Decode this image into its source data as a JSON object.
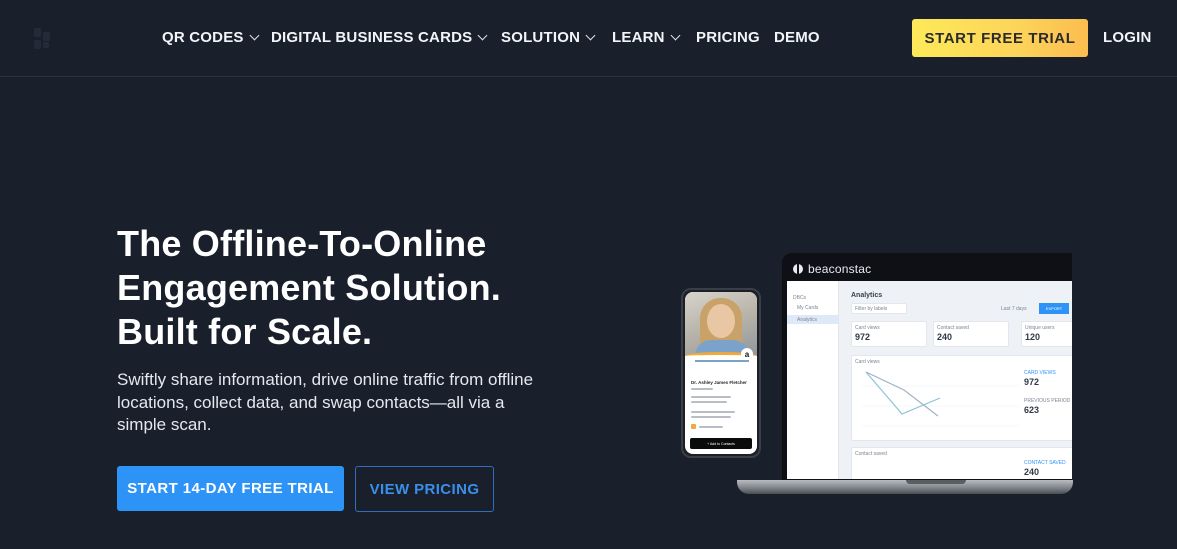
{
  "nav": {
    "items": [
      {
        "label": "QR CODES",
        "has_dropdown": true
      },
      {
        "label": "DIGITAL BUSINESS CARDS",
        "has_dropdown": true
      },
      {
        "label": "SOLUTION",
        "has_dropdown": true
      },
      {
        "label": "LEARN",
        "has_dropdown": true
      },
      {
        "label": "PRICING",
        "has_dropdown": false
      },
      {
        "label": "DEMO",
        "has_dropdown": false
      }
    ],
    "cta_label": "START FREE TRIAL",
    "login_label": "LOGIN"
  },
  "hero": {
    "title_lines": [
      "The Offline-To-Online",
      "Engagement Solution.",
      "Built for Scale."
    ],
    "subtitle": "Swiftly share information, drive online traffic from offline locations, collect data, and swap contacts—all via a simple scan.",
    "primary_button": "START 14-DAY FREE TRIAL",
    "secondary_button": "VIEW PRICING"
  },
  "mockup": {
    "laptop": {
      "brand": "beaconstac",
      "sidebar": {
        "section": "DBCs",
        "items": [
          "My Cards",
          "Analytics"
        ],
        "active": "Analytics"
      },
      "page_title": "Analytics",
      "filter_placeholder": "Filter by labels",
      "range": "Last 7 days",
      "export_label": "EXPORT",
      "stats": [
        {
          "label": "Card views",
          "value": "972"
        },
        {
          "label": "Contact saved",
          "value": "240"
        },
        {
          "label": "Unique users",
          "value": "120"
        }
      ],
      "chart_title": "Card views",
      "legend": [
        {
          "label": "CARD VIEWS",
          "value": "972"
        },
        {
          "label": "PREVIOUS PERIOD",
          "value": "623"
        }
      ],
      "second_chart_title": "Contact saved",
      "second_legend": {
        "label": "CONTACT SAVED",
        "value": "240"
      }
    },
    "phone": {
      "name": "Dr. Ashley James Fletcher",
      "button_label": "+ Add to Contacts"
    }
  },
  "colors": {
    "background": "#19202c",
    "accent_blue": "#2d93f6",
    "cta_yellow": "#fde95a"
  }
}
